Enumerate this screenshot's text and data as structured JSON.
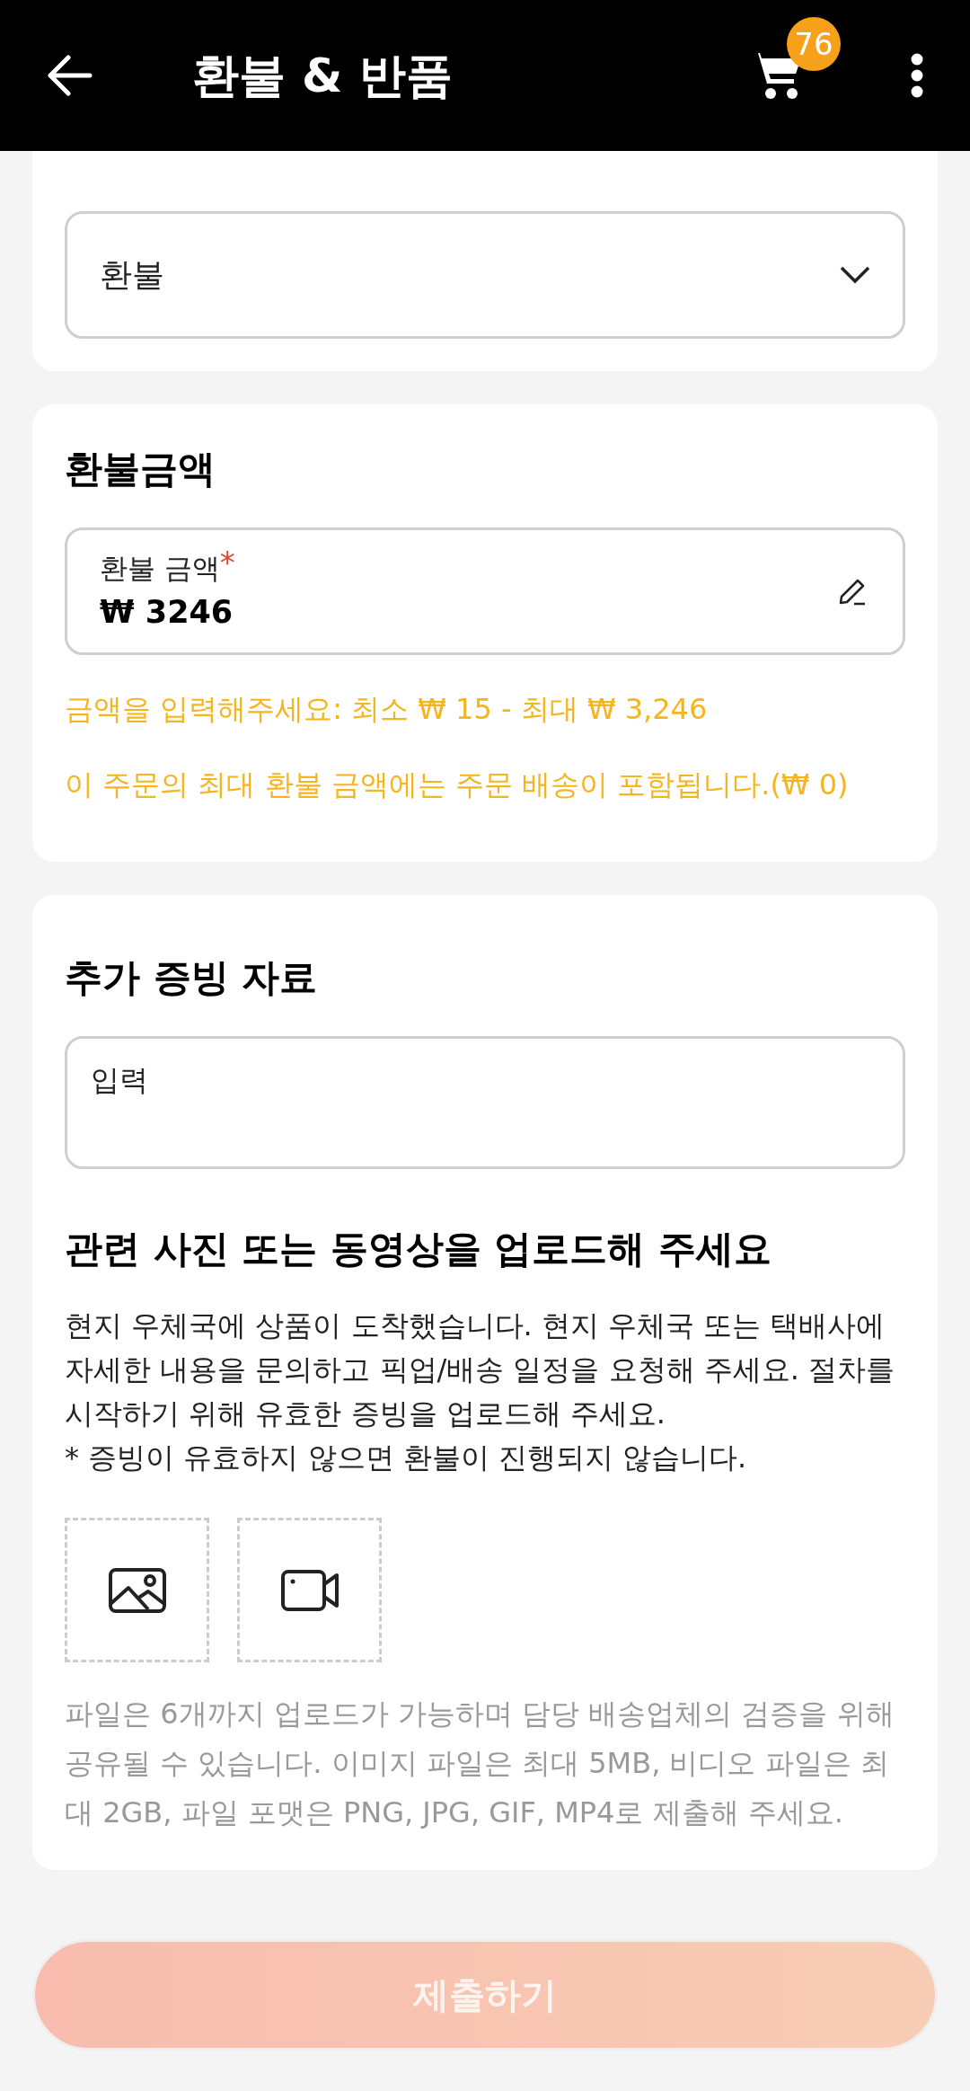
{
  "header": {
    "title": "환불 & 반품",
    "cart_badge": "76"
  },
  "request_type": {
    "value": "환불"
  },
  "refund_amount": {
    "title": "환불금액",
    "field_label": "환불 금액",
    "required_mark": "*",
    "value": "₩ 3246",
    "hints": [
      "금액을 입력해주세요: 최소 ₩ 15 - 최대 ₩ 3,246",
      "이 주문의 최대 환불 금액에는 주문 배송이 포함됩니다.(₩ 0)"
    ]
  },
  "evidence": {
    "title": "추가 증빙 자료",
    "placeholder": "입력",
    "upload_title": "관련 사진 또는 동영상을 업로드해 주세요",
    "description": "현지 우체국에 상품이 도착했습니다. 현지 우체국 또는 택배사에 자세한 내용을 문의하고 픽업/배송 일정을 요청해 주세요. 절차를 시작하기 위해 유효한 증빙을 업로드해 주세요.",
    "note": "* 증빙이 유효하지 않으면 환불이 진행되지 않습니다.",
    "uploads": [
      {
        "kind": "image"
      },
      {
        "kind": "video"
      }
    ],
    "file_note": "파일은 6개까지 업로드가 가능하며 담당 배송업체의 검증을 위해 공유될 수 있습니다. 이미지 파일은 최대 5MB, 비디오 파일은 최대 2GB, 파일 포맷은 PNG, JPG, GIF, MP4로 제출해 주세요."
  },
  "submit": {
    "label": "제출하기",
    "disabled": true
  }
}
